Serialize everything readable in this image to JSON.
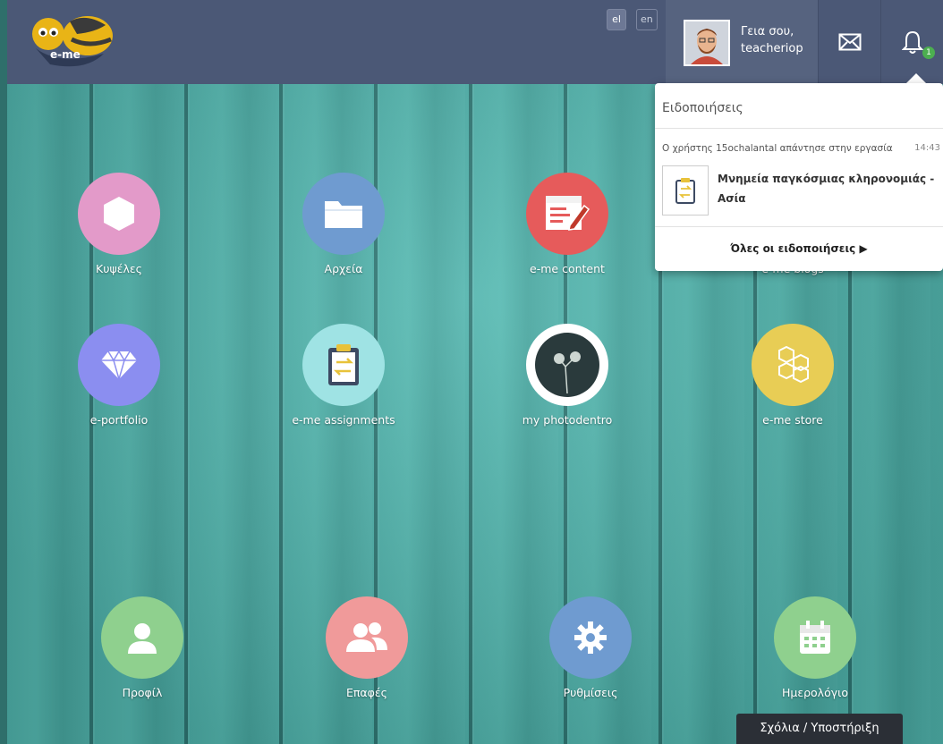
{
  "header": {
    "logo_text": "e-me",
    "languages": [
      "el",
      "en"
    ],
    "greeting_line1": "Γεια σου,",
    "greeting_line2": "teacheriop",
    "notification_count": "1"
  },
  "apps_row1": [
    {
      "label": "Κυψέλες",
      "color": "#e39ac9"
    },
    {
      "label": "Αρχεία",
      "color": "#6f9bd0"
    },
    {
      "label": "e-me content",
      "color": "#e65b5b"
    },
    {
      "label": "e-me blogs",
      "color": "#8a96c8"
    }
  ],
  "apps_row2": [
    {
      "label": "e-portfolio",
      "color": "#8b8ef0"
    },
    {
      "label": "e-me assignments",
      "color": "#9fe3e4"
    },
    {
      "label": "my photodentro",
      "color": "#ffffff"
    },
    {
      "label": "e-me store",
      "color": "#e8cd55"
    }
  ],
  "apps_row3": [
    {
      "label": "Προφίλ",
      "color": "#8fd08e"
    },
    {
      "label": "Επαφές",
      "color": "#f09a9a"
    },
    {
      "label": "Ρυθμίσεις",
      "color": "#6f9bd0"
    },
    {
      "label": "Ημερολόγιο",
      "color": "#8fd08e"
    }
  ],
  "notifications": {
    "title": "Ειδοποιήσεις",
    "item_text": "Ο χρήστης 15ochalantal απάντησε στην εργασία",
    "item_time": "14:43",
    "item_title": "Μνημεία παγκόσμιας κληρονομιάς - Ασία",
    "all_label": "Όλες οι ειδοποιήσεις ▶"
  },
  "feedback_label": "Σχόλια / Υποστήριξη"
}
